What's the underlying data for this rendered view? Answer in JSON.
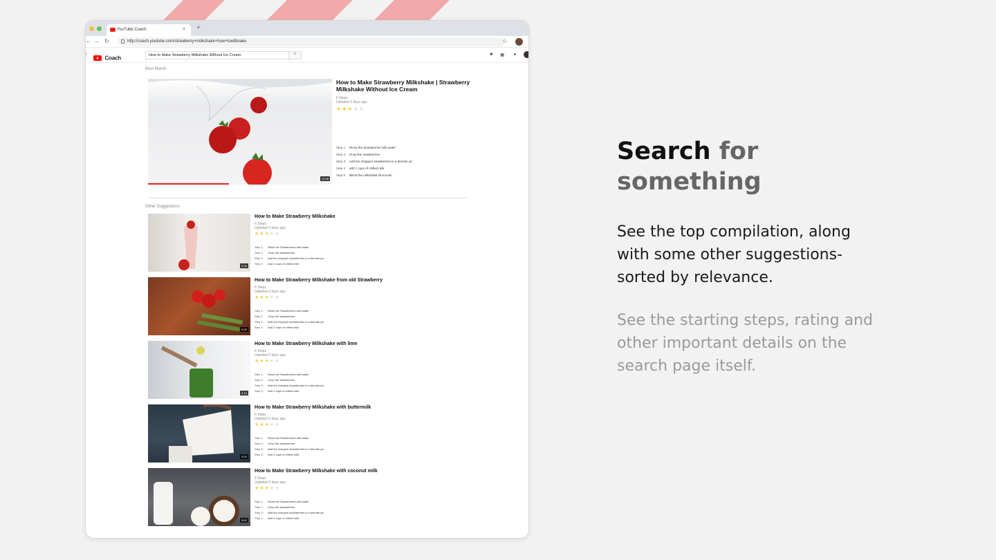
{
  "browser": {
    "tab_title": "YouTube Coach",
    "tab_close": "×",
    "new_tab": "+",
    "url": "http://coach.youtube.com/strawberry+milkshake+how+tow$make"
  },
  "yt": {
    "logo_text": "Coach",
    "search_value": "How to Make Strawberry Milkshake Without Ice Cream",
    "search_button_icon": "search-icon",
    "hamburger": "≡"
  },
  "best_match": {
    "label": "Best March",
    "title": "How to Make Strawberry Milkshake | Strawberry Milkshake Without Ice Cream",
    "steps_count": "6 Steps",
    "updated": "Updated 3 days ago",
    "rating": 3,
    "duration": "12:46",
    "progress": 0.44,
    "steps": [
      {
        "k": "Step 1:",
        "v": "Rinse the Strawberries with water"
      },
      {
        "k": "Step 2:",
        "v": "Chop the strawberries"
      },
      {
        "k": "Step 3:",
        "v": "Add the chopped strawberries to a blender jar"
      },
      {
        "k": "Step 4:",
        "v": "add 1 cups of chilled milk"
      },
      {
        "k": "Step 5:",
        "v": "Blend the milkshake till smooth"
      }
    ]
  },
  "other": {
    "label": "Other Suggestions",
    "items": [
      {
        "title": "How to Make Strawberry Milkshake",
        "steps_count": "6 Steps",
        "updated": "Updated 3 days ago",
        "rating": 3,
        "duration": "5:26",
        "steps": [
          {
            "k": "Step 1:",
            "v": "Rinse the Strawberries with water"
          },
          {
            "k": "Step 2:",
            "v": "Chop the strawberries."
          },
          {
            "k": "Step 3:",
            "v": "Add the chopped strawberries to a blender jar"
          },
          {
            "k": "Step 4:",
            "v": "Add 2 cups of chilled milk."
          }
        ]
      },
      {
        "title": "How to Make Strawberry Milkshake from old Strawberry",
        "steps_count": "6 Steps",
        "updated": "Updated 3 days ago",
        "rating": 3,
        "duration": "6:32",
        "steps": [
          {
            "k": "Step 1:",
            "v": "Rinse the Strawberries with water"
          },
          {
            "k": "Step 2:",
            "v": "Chop the strawberries."
          },
          {
            "k": "Step 3:",
            "v": "Add the chopped strawberries to a blender jar"
          },
          {
            "k": "Step 4:",
            "v": "Add 2 cups of chilled milk."
          }
        ]
      },
      {
        "title": "How to Make Strawberry Milkshake with lime",
        "steps_count": "6 Steps",
        "updated": "Updated 3 days ago",
        "rating": 3,
        "duration": "4:10",
        "steps": [
          {
            "k": "Step 1:",
            "v": "Rinse the Strawberries with water"
          },
          {
            "k": "Step 2:",
            "v": "Chop the strawberries."
          },
          {
            "k": "Step 3:",
            "v": "Add the chopped strawberries to a blender jar"
          },
          {
            "k": "Step 4:",
            "v": "Add 2 cups of chilled milk."
          }
        ]
      },
      {
        "title": "How to Make Strawberry Milkshake with buttermilk",
        "steps_count": "6 Steps",
        "updated": "Updated 3 days ago",
        "rating": 3,
        "duration": "5:20",
        "steps": [
          {
            "k": "Step 1:",
            "v": "Rinse the Strawberries with water"
          },
          {
            "k": "Step 2:",
            "v": "Chop the strawberries."
          },
          {
            "k": "Step 3:",
            "v": "Add the chopped strawberries to a blender jar"
          },
          {
            "k": "Step 4:",
            "v": "Add 2 cups of chilled milk."
          }
        ]
      },
      {
        "title": "How to Make Strawberry Milkshake with coconut milk",
        "steps_count": "6 Steps",
        "updated": "Updated 3 days ago",
        "rating": 3,
        "duration": "5:02",
        "steps": [
          {
            "k": "Step 1:",
            "v": "Rinse the Strawberries with water"
          },
          {
            "k": "Step 2:",
            "v": "Chop the strawberries."
          },
          {
            "k": "Step 3:",
            "v": "Add the chopped strawberries to a blender jar"
          },
          {
            "k": "Step 4:",
            "v": "Add 2 cups of chilled milk."
          }
        ]
      }
    ]
  },
  "panel": {
    "headline_bold": "Search",
    "headline_grey": "for something",
    "para1": "See the top compilation, along with some other suggestions- sorted by relevance.",
    "para2": "See the starting steps, rating and other important details on the search page itself."
  },
  "colors": {
    "accent_red": "#e62117",
    "stripe": "#f2a9a9",
    "star_on": "#f7ca45",
    "star_off": "#dddddd"
  }
}
